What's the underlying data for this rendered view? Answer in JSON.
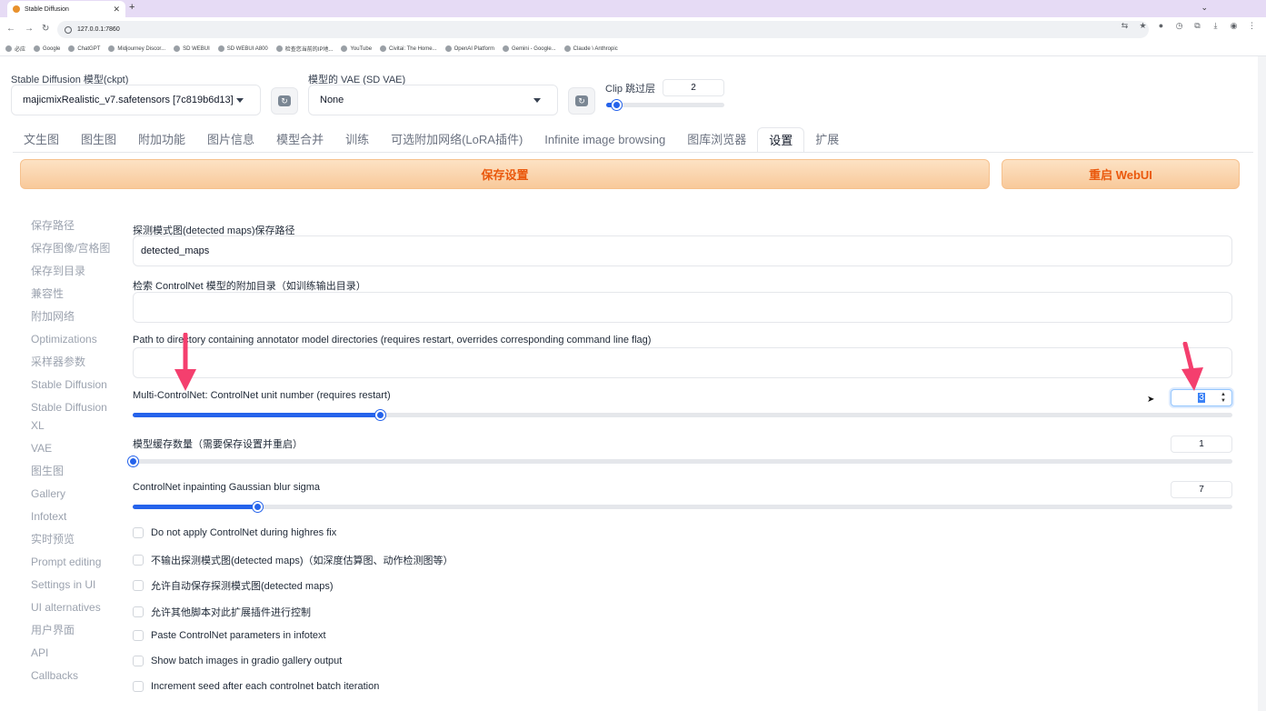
{
  "browser": {
    "tab_title": "Stable Diffusion",
    "url": "127.0.0.1:7860",
    "bookmarks": [
      "必应",
      "Google",
      "ChatGPT",
      "Midjourney Discor...",
      "SD WEBUI",
      "SD WEBUI A800",
      "检查您当前的IP地...",
      "YouTube",
      "Civitai: The Home...",
      "OpenAI Platform",
      "Gemini - Google...",
      "Claude \\ Anthropic"
    ]
  },
  "top": {
    "ckpt_label": "Stable Diffusion 模型(ckpt)",
    "ckpt_value": "majicmixRealistic_v7.safetensors [7c819b6d13]",
    "vae_label": "模型的 VAE (SD VAE)",
    "vae_value": "None",
    "clip_label": "Clip 跳过层",
    "clip_value": "2",
    "clip_slider_fraction": 0.083
  },
  "tabs": [
    "文生图",
    "图生图",
    "附加功能",
    "图片信息",
    "模型合并",
    "训练",
    "可选附加网络(LoRA插件)",
    "Infinite image browsing",
    "图库浏览器",
    "设置",
    "扩展"
  ],
  "active_tab": "设置",
  "buttons": {
    "save": "保存设置",
    "restart": "重启 WebUI"
  },
  "sidenav": [
    "保存路径",
    "保存图像/宫格图",
    "保存到目录",
    "兼容性",
    "附加网络",
    "Optimizations",
    "采样器参数",
    "Stable Diffusion",
    "Stable Diffusion XL",
    "VAE",
    "图生图",
    "Gallery",
    "Infotext",
    "实时预览",
    "Prompt editing",
    "Settings in UI",
    "UI alternatives",
    "用户界面",
    "API",
    "Callbacks"
  ],
  "settings": {
    "detected_maps_label": "探测模式图(detected maps)保存路径",
    "detected_maps_value": "detected_maps",
    "extra_dir_label": "检索 ControlNet 模型的附加目录（如训练输出目录）",
    "extra_dir_value": "",
    "annotator_label": "Path to directory containing annotator model directories (requires restart, overrides corresponding command line flag)",
    "annotator_value": "",
    "multi_label": "Multi-ControlNet: ControlNet unit number (requires restart)",
    "multi_value": "3",
    "multi_fraction": 0.225,
    "cache_label": "模型缓存数量（需要保存设置并重启）",
    "cache_value": "1",
    "cache_fraction": 0.0,
    "blur_label": "ControlNet inpainting Gaussian blur sigma",
    "blur_value": "7",
    "blur_fraction": 0.113
  },
  "checkboxes": [
    "Do not apply ControlNet during highres fix",
    "不输出探测模式图(detected maps)（如深度估算图、动作检测图等）",
    "允许自动保存探测模式图(detected maps)",
    "允许其他脚本对此扩展插件进行控制",
    "Paste ControlNet parameters in infotext",
    "Show batch images in gradio gallery output",
    "Increment seed after each controlnet batch iteration"
  ],
  "colors": {
    "accent": "#2563eb",
    "button_text": "#ea580c",
    "annotation_arrow": "#f43f6e",
    "browser_tabbar": "#e6dbf5"
  }
}
